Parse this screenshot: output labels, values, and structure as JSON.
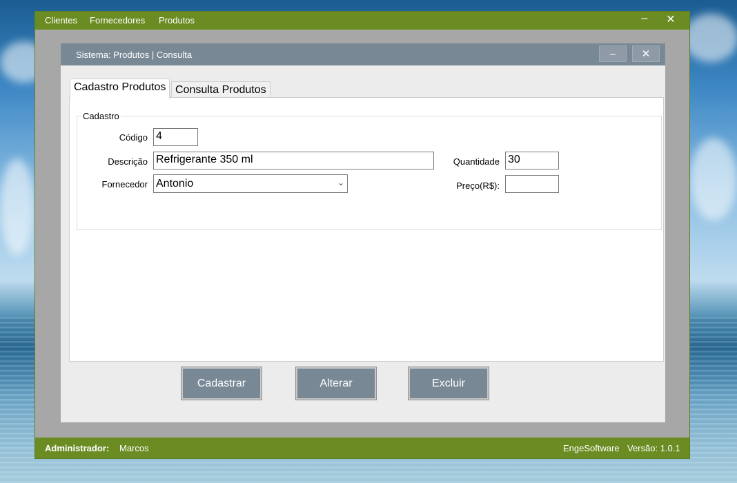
{
  "menu": {
    "items": [
      "Clientes",
      "Fornecedores",
      "Produtos"
    ],
    "minimize_glyph": "–",
    "close_glyph": "✕"
  },
  "child_window": {
    "title": "Sistema: Produtos | Consulta",
    "minimize_glyph": "–",
    "close_glyph": "✕"
  },
  "tabs": [
    "Cadastro Produtos",
    "Consulta Produtos"
  ],
  "form": {
    "group_title": "Cadastro",
    "codigo_label": "Código",
    "codigo_value": "4",
    "descricao_label": "Descrição",
    "descricao_value": "Refrigerante 350 ml",
    "fornecedor_label": "Fornecedor",
    "fornecedor_value": "Antonio",
    "quantidade_label": "Quantidade",
    "quantidade_value": "30",
    "preco_label": "Preço(R$):",
    "preco_value": ""
  },
  "buttons": {
    "cadastrar": "Cadastrar",
    "alterar": "Alterar",
    "excluir": "Excluir"
  },
  "status": {
    "admin_label": "Administrador:",
    "admin_name": "Marcos",
    "company": "EngeSoftware",
    "version": "Versão: 1.0.1"
  },
  "colors": {
    "accent_green": "#6b8c23",
    "slate": "#788895"
  }
}
